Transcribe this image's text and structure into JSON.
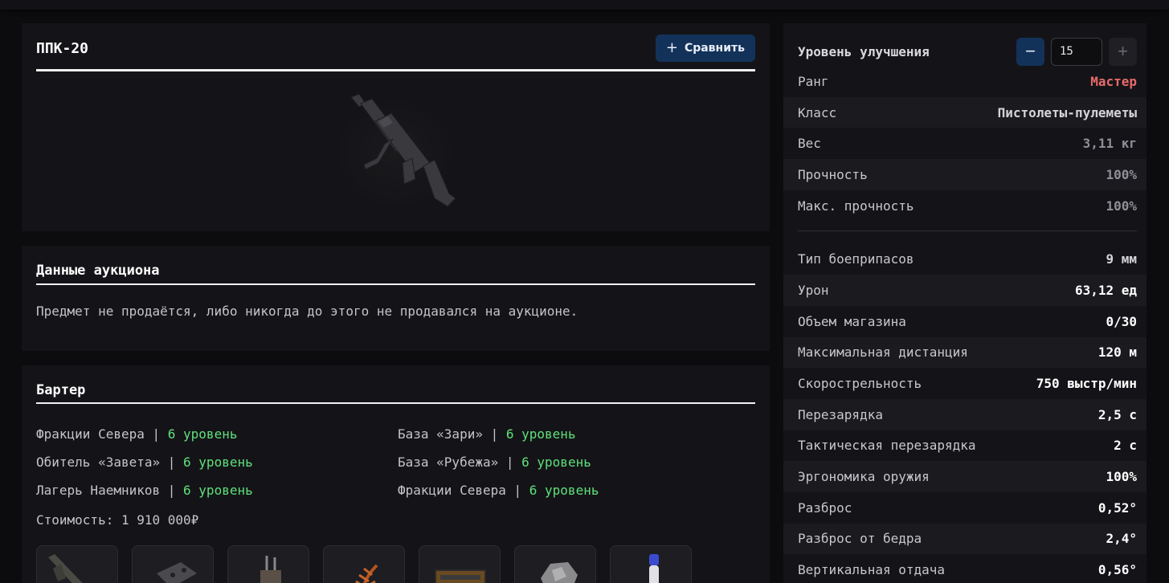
{
  "item": {
    "title": "ППК-20",
    "compare_label": "Сравнить",
    "weapon_icon": "smg-icon"
  },
  "auction": {
    "title": "Данные аукциона",
    "text": "Предмет не продаётся, либо никогда до этого не продавался на аукционе."
  },
  "barter": {
    "title": "Бартер",
    "rows": [
      [
        {
          "name": "Фракции Севера",
          "level": "6 уровень"
        },
        {
          "name": "База «Зари»",
          "level": "6 уровень"
        }
      ],
      [
        {
          "name": "Обитель «Завета»",
          "level": "6 уровень"
        },
        {
          "name": "База «Рубежа»",
          "level": "6 уровень"
        }
      ],
      [
        {
          "name": "Лагерь Наемников",
          "level": "6 уровень"
        },
        {
          "name": "Фракции Севера",
          "level": "6 уровень"
        }
      ]
    ],
    "cost": "Стоимость: 1 910 000₽",
    "thumbnails": [
      "rifle-icon",
      "plate-icon",
      "spark-plugs-icon",
      "fern-icon",
      "case-icon",
      "ore-icon",
      "vial-icon"
    ]
  },
  "stats": {
    "upgrade_label": "Уровень улучшения",
    "upgrade_value": "15",
    "group1": [
      {
        "k": "Ранг",
        "v": "Мастер",
        "style": "red"
      },
      {
        "k": "Класс",
        "v": "Пистолеты-пулеметы",
        "style": "light"
      },
      {
        "k": "Вес",
        "v": "3,11 кг",
        "style": "gray"
      },
      {
        "k": "Прочность",
        "v": "100%",
        "style": "gray"
      },
      {
        "k": "Макс. прочность",
        "v": "100%",
        "style": "gray"
      }
    ],
    "group2": [
      {
        "k": "Тип боеприпасов",
        "v": "9 мм",
        "style": "light"
      },
      {
        "k": "Урон",
        "v": "63,12 ед",
        "style": ""
      },
      {
        "k": "Объем магазина",
        "v": "0/30",
        "style": ""
      },
      {
        "k": "Максимальная дистанция",
        "v": "120 м",
        "style": ""
      },
      {
        "k": "Скорострельность",
        "v": "750 выстр/мин",
        "style": ""
      },
      {
        "k": "Перезарядка",
        "v": "2,5 с",
        "style": ""
      },
      {
        "k": "Тактическая перезарядка",
        "v": "2 с",
        "style": ""
      },
      {
        "k": "Эргономика оружия",
        "v": "100%",
        "style": ""
      },
      {
        "k": "Разброс",
        "v": "0,52°",
        "style": ""
      },
      {
        "k": "Разброс от бедра",
        "v": "2,4°",
        "style": ""
      },
      {
        "k": "Вертикальная отдача",
        "v": "0,56°",
        "style": ""
      }
    ]
  }
}
